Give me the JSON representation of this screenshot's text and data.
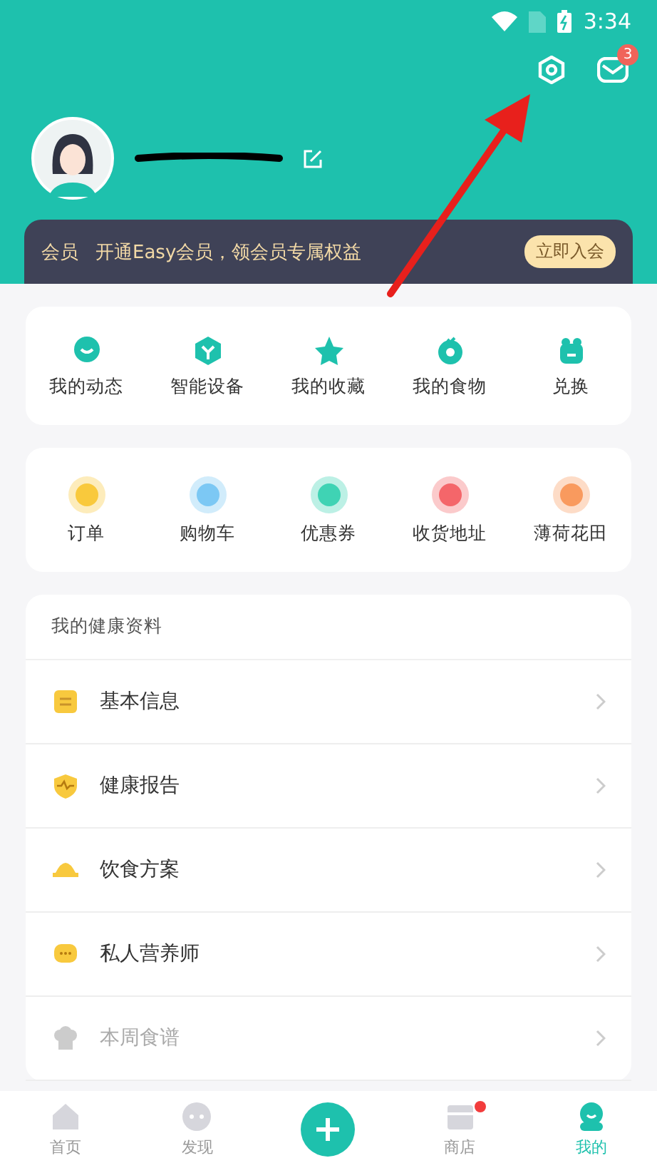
{
  "status_bar": {
    "time": "3:34"
  },
  "header": {
    "message_count": "3"
  },
  "membership": {
    "label": "会员",
    "text": "开通Easy会员，领会员专属权益",
    "button": "立即入会"
  },
  "shortcuts": [
    {
      "label": "我的动态",
      "kind": "chat"
    },
    {
      "label": "智能设备",
      "kind": "device"
    },
    {
      "label": "我的收藏",
      "kind": "star"
    },
    {
      "label": "我的食物",
      "kind": "fruit"
    },
    {
      "label": "兑换",
      "kind": "gift"
    }
  ],
  "services": [
    {
      "label": "订单",
      "color": "#f9c93c"
    },
    {
      "label": "购物车",
      "color": "#7cc8f4"
    },
    {
      "label": "优惠券",
      "color": "#3fd3b4"
    },
    {
      "label": "收货地址",
      "color": "#f4666a"
    },
    {
      "label": "薄荷花田",
      "color": "#f99a5e"
    }
  ],
  "health": {
    "title": "我的健康资料",
    "items": [
      {
        "label": "基本信息",
        "kind": "doc",
        "disabled": false
      },
      {
        "label": "健康报告",
        "kind": "shield",
        "disabled": false
      },
      {
        "label": "饮食方案",
        "kind": "dish",
        "disabled": false
      },
      {
        "label": "私人营养师",
        "kind": "bubble",
        "disabled": false
      },
      {
        "label": "本周食谱",
        "kind": "chef",
        "disabled": true
      }
    ]
  },
  "nav": [
    {
      "label": "首页",
      "kind": "home",
      "selected": false,
      "dot": false
    },
    {
      "label": "发现",
      "kind": "discover",
      "selected": false,
      "dot": false
    },
    {
      "kind": "add"
    },
    {
      "label": "商店",
      "kind": "shop",
      "selected": false,
      "dot": true
    },
    {
      "label": "我的",
      "kind": "me",
      "selected": true,
      "dot": false
    }
  ]
}
